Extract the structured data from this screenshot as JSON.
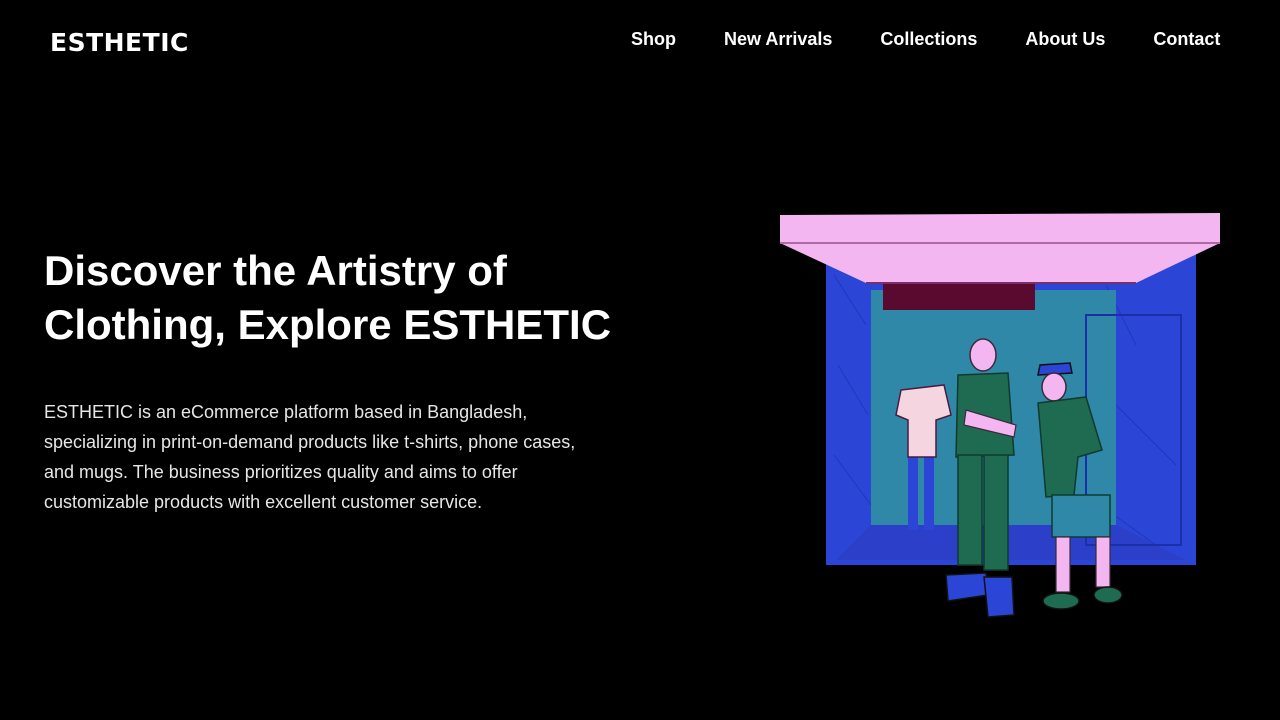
{
  "brand": {
    "logo_text": "ESTHETIC"
  },
  "nav": {
    "items": [
      {
        "label": "Shop"
      },
      {
        "label": "New Arrivals"
      },
      {
        "label": "Collections"
      },
      {
        "label": "About Us"
      },
      {
        "label": "Contact"
      }
    ]
  },
  "hero": {
    "title": "Discover the Artistry of Clothing, Explore ESTHETIC",
    "description": "ESTHETIC is an eCommerce platform based in Bangladesh, specializing in print-on-demand products like t-shirts, phone cases, and mugs. The business prioritizes quality and aims to offer customizable products with excellent customer service."
  },
  "colors": {
    "background": "#000000",
    "text": "#ffffff",
    "awning": "#f3b6f0",
    "shop_blue": "#2b45d6",
    "interior_teal": "#2f88a8",
    "sign": "#5a0a2e",
    "clothing_green": "#1f6b52"
  }
}
